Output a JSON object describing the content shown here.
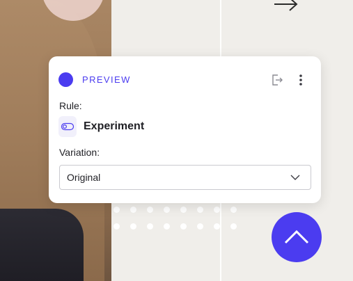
{
  "card": {
    "badge_label": "PREVIEW",
    "rule_label": "Rule:",
    "rule_value": "Experiment",
    "variation_label": "Variation:",
    "variation_selected": "Original"
  },
  "icons": {
    "status": "status-dot-icon",
    "exit": "exit-preview-icon",
    "menu": "more-vertical-icon",
    "rule": "toggle-icon",
    "select": "chevron-down-icon",
    "fab": "chevron-up-icon",
    "bg_arrow": "arrow-right-icon"
  },
  "colors": {
    "accent": "#4b3cf0",
    "text": "#1f1f24",
    "card_bg": "#ffffff",
    "page_bg": "#f0eeea"
  }
}
